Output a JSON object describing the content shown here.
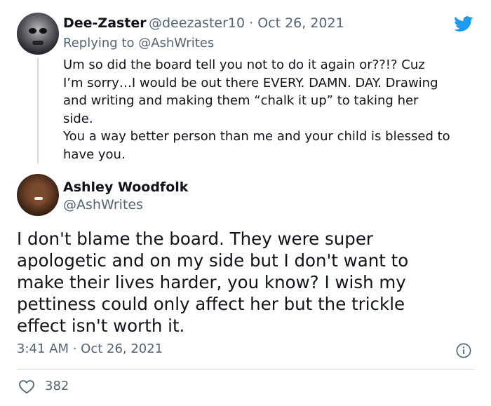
{
  "reply_tweet": {
    "display_name": "Dee-Zaster",
    "handle_date": "@deezaster10 · Oct 26, 2021",
    "replying_prefix": "Replying to ",
    "replying_handle": "@AshWrites",
    "text": "Um so did the board tell you not to do it again or??!?  Cuz\nI’m sorry…I would be out there EVERY. DAMN. DAY. Drawing\nand writing and making them “chalk it up” to taking her\nside.\nYou a way better person than me and your child is blessed to\nhave you."
  },
  "main_tweet": {
    "display_name": "Ashley Woodfolk",
    "handle": "@AshWrites",
    "text": "I don't blame the board. They were super\napologetic and on my side but I don't want to\nmake their lives harder, you know? I wish my\npettiness could only affect her but the trickle\neffect isn't worth it.",
    "timestamp": "3:41 AM · Oct 26, 2021",
    "like_count": "382"
  },
  "colors": {
    "twitter_blue": "#1d9bf0",
    "secondary_text": "#536471",
    "divider": "#cfd9de"
  },
  "icons": [
    "twitter-bird-icon",
    "info-icon",
    "heart-icon"
  ]
}
